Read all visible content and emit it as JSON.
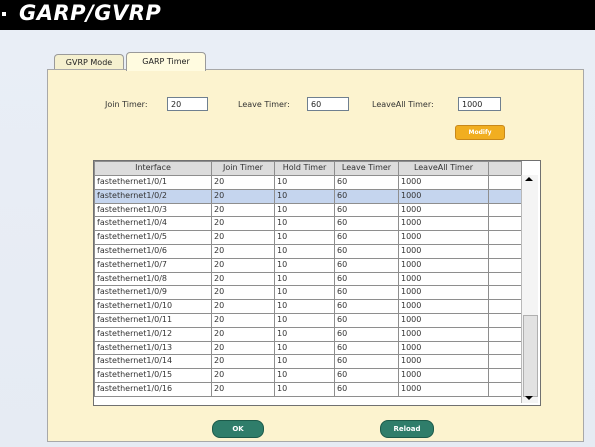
{
  "page": {
    "title": "GARP/GVRP"
  },
  "tabs": [
    {
      "label": "GVRP Mode",
      "active": false
    },
    {
      "label": "GARP Timer",
      "active": true
    }
  ],
  "timers": {
    "join_label": "Join Timer:",
    "join_value": "20",
    "leave_label": "Leave Timer:",
    "leave_value": "60",
    "leaveall_label": "LeaveAll Timer:",
    "leaveall_value": "1000",
    "modify_label": "Modify"
  },
  "table": {
    "columns": [
      "Interface",
      "Join Timer",
      "Hold Timer",
      "Leave Timer",
      "LeaveAll Timer"
    ],
    "selected_row": 1,
    "rows": [
      [
        "fastethernet1/0/1",
        "20",
        "10",
        "60",
        "1000"
      ],
      [
        "fastethernet1/0/2",
        "20",
        "10",
        "60",
        "1000"
      ],
      [
        "fastethernet1/0/3",
        "20",
        "10",
        "60",
        "1000"
      ],
      [
        "fastethernet1/0/4",
        "20",
        "10",
        "60",
        "1000"
      ],
      [
        "fastethernet1/0/5",
        "20",
        "10",
        "60",
        "1000"
      ],
      [
        "fastethernet1/0/6",
        "20",
        "10",
        "60",
        "1000"
      ],
      [
        "fastethernet1/0/7",
        "20",
        "10",
        "60",
        "1000"
      ],
      [
        "fastethernet1/0/8",
        "20",
        "10",
        "60",
        "1000"
      ],
      [
        "fastethernet1/0/9",
        "20",
        "10",
        "60",
        "1000"
      ],
      [
        "fastethernet1/0/10",
        "20",
        "10",
        "60",
        "1000"
      ],
      [
        "fastethernet1/0/11",
        "20",
        "10",
        "60",
        "1000"
      ],
      [
        "fastethernet1/0/12",
        "20",
        "10",
        "60",
        "1000"
      ],
      [
        "fastethernet1/0/13",
        "20",
        "10",
        "60",
        "1000"
      ],
      [
        "fastethernet1/0/14",
        "20",
        "10",
        "60",
        "1000"
      ],
      [
        "fastethernet1/0/15",
        "20",
        "10",
        "60",
        "1000"
      ],
      [
        "fastethernet1/0/16",
        "20",
        "10",
        "60",
        "1000"
      ]
    ]
  },
  "actions": {
    "ok_label": "OK",
    "reload_label": "Reload"
  },
  "colors": {
    "panel": "#fcf3cf",
    "selected_row": "#c5d5ee",
    "modify_button": "#f1ae20",
    "action_button": "#2f7d6a",
    "title_bar": "#000000"
  }
}
